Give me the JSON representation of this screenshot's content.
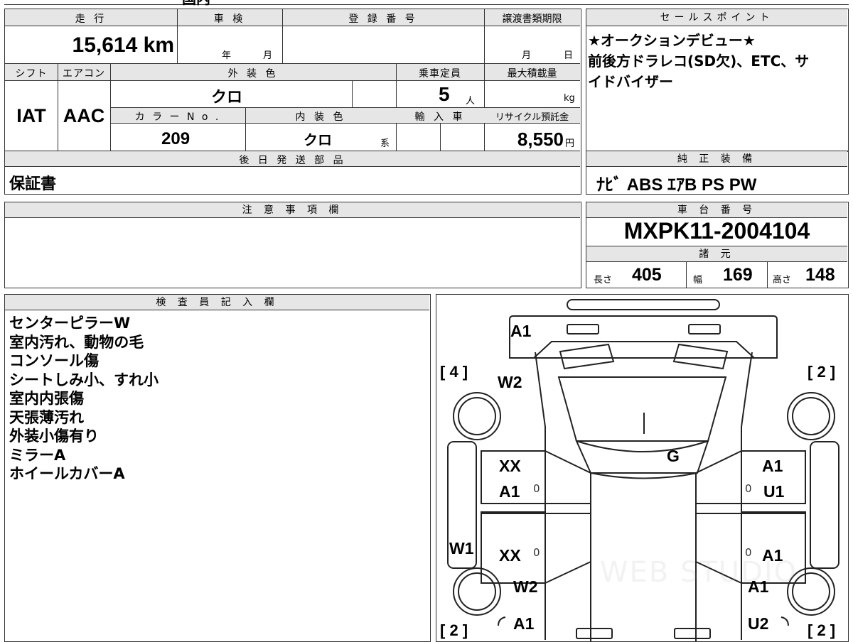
{
  "top_partial_text": "国内",
  "vehicle": {
    "mileage_label": "走 行",
    "mileage": "15,614 km",
    "shaken_label": "車 検",
    "shaken_year": "年",
    "shaken_month": "月",
    "reg_label": "登 録 番 号",
    "transfer_label": "譲渡書類期限",
    "transfer_month": "月",
    "transfer_day": "日",
    "shift_label": "シフト",
    "shift": "IAT",
    "ac_label": "エアコン",
    "ac": "AAC",
    "ext_color_label": "外 装 色",
    "ext_color": "クロ",
    "capacity_label": "乗車定員",
    "capacity": "5",
    "capacity_unit": "人",
    "max_load_label": "最大積載量",
    "max_load_unit": "kg",
    "color_no_label": "カ ラ ー N o .",
    "color_no": "209",
    "int_color_label": "内 装 色",
    "int_color": "クロ",
    "int_color_suffix": "系",
    "import_label": "輸 入 車",
    "recycle_label": "リサイクル預託金",
    "recycle": "8,550",
    "recycle_unit": "円",
    "later_parts_label": "後 日 発 送 部 品",
    "later_parts": "保証書"
  },
  "sales_points": {
    "label": "セールスポイント",
    "lines": [
      "★オークションデビュー★",
      "前後方ドラレコ(SD欠)、ETC、サ",
      "イドバイザー"
    ]
  },
  "equipment": {
    "label": "純 正 装 備",
    "value": "ﾅﾋﾞ ABS ｴｱB PS PW"
  },
  "cautions": {
    "label": "注 意 事 項 欄"
  },
  "chassis": {
    "label": "車 台 番 号",
    "number": "MXPK11-2004104",
    "spec_label": "諸 元",
    "length_label": "長さ",
    "length": "405",
    "width_label": "幅",
    "width": "169",
    "height_label": "高さ",
    "height": "148"
  },
  "inspector": {
    "label": "検 査 員 記 入 欄",
    "notes": [
      "センターピラーW",
      "室内汚れ、動物の毛",
      "コンソール傷",
      "シートしみ小、すれ小",
      "室内内張傷",
      "天張薄汚れ",
      "外装小傷有り",
      "ミラーA",
      "ホイールカバーA"
    ]
  },
  "diagram": {
    "tires": [
      "[ 4 ]",
      "[ 2 ]",
      "[ 2 ]",
      "[ 2 ]"
    ],
    "marks": [
      "A1",
      "W2",
      "G",
      "XX",
      "A1",
      "A1",
      "U1",
      "W1",
      "XX",
      "A1",
      "W2",
      "A1",
      "A1",
      "U2"
    ],
    "zeros": [
      "0",
      "0",
      "0",
      "0"
    ],
    "watermark": "WEB STUDIO"
  }
}
